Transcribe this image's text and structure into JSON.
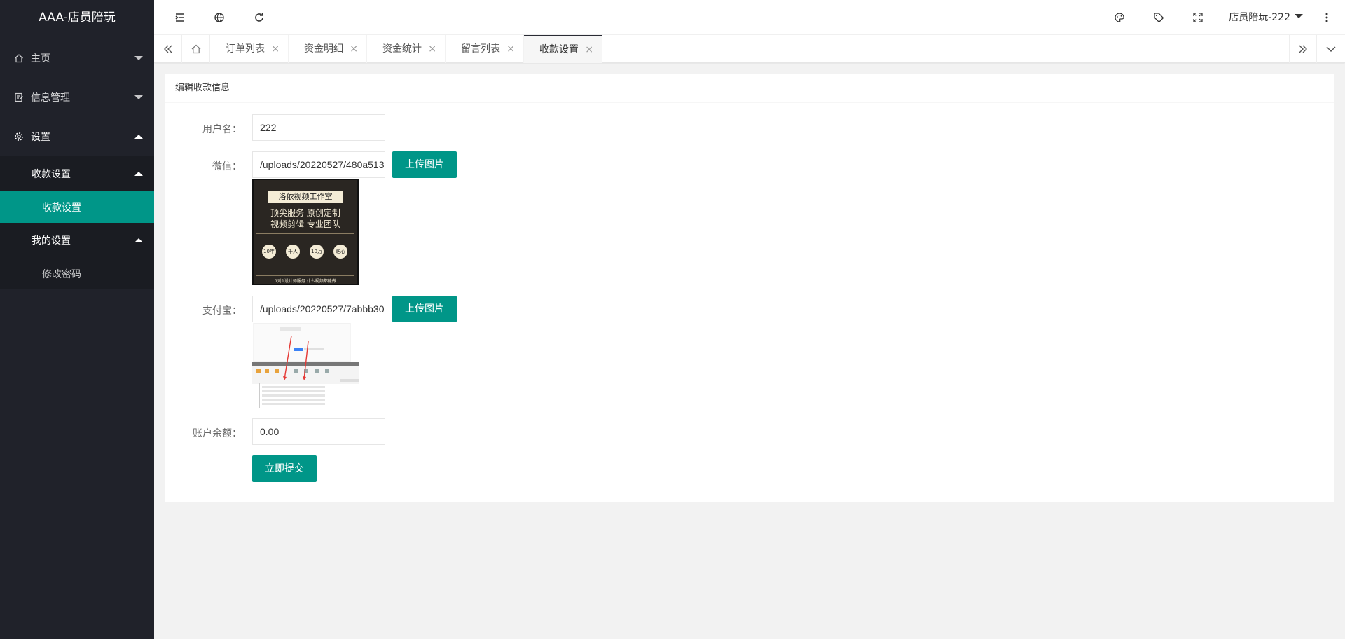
{
  "sidebar": {
    "logo": "AAA-店员陪玩",
    "items": [
      {
        "label": "主页"
      },
      {
        "label": "信息管理"
      },
      {
        "label": "设置"
      }
    ],
    "settings_group": {
      "label": "收款设置",
      "child": "收款设置"
    },
    "my_group": {
      "label": "我的设置",
      "child": "修改密码"
    }
  },
  "header": {
    "user": "店员陪玩-222"
  },
  "tabs": [
    {
      "label": "订单列表",
      "close": "×"
    },
    {
      "label": "资金明细",
      "close": "×"
    },
    {
      "label": "资金统计",
      "close": "×"
    },
    {
      "label": "留言列表",
      "close": "×"
    },
    {
      "label": "收款设置",
      "close": "×"
    }
  ],
  "form": {
    "title": "编辑收款信息",
    "username_label": "用户名：",
    "username_value": "222",
    "wechat_label": "微信：",
    "wechat_value": "/uploads/20220527/480a513",
    "alipay_label": "支付宝：",
    "alipay_value": "/uploads/20220527/7abbb30",
    "upload_label": "上传图片",
    "balance_label": "账户余额：",
    "balance_value": "0.00",
    "submit_label": "立即提交"
  },
  "wechat_image": {
    "banner": "洛依视频工作室",
    "line1": "顶尖服务  原创定制",
    "line2": "视频剪辑  专业团队",
    "badges": [
      "10年",
      "千人",
      "10万",
      "贴心"
    ],
    "footer": "1对1设计师服务 什么视频都能做"
  },
  "colors": {
    "sidebar_bg": "#20222a",
    "accent": "#009688",
    "page_bg": "#f2f2f2"
  },
  "icons": [
    "home-icon",
    "info-manage-icon",
    "settings-gear-icon",
    "menu-fold-icon",
    "globe-icon",
    "refresh-icon",
    "theme-palette-icon",
    "tag-icon",
    "fullscreen-icon",
    "more-vertical-icon"
  ]
}
